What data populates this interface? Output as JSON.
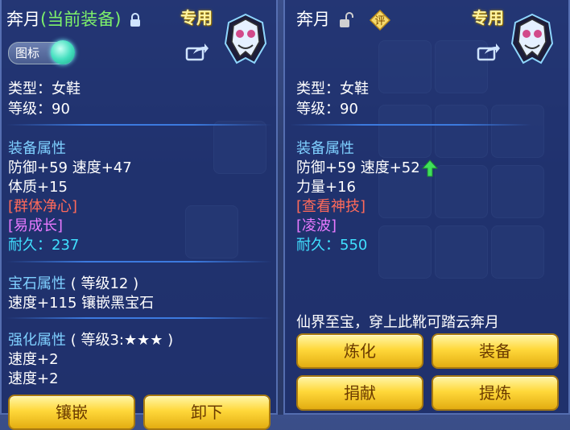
{
  "left": {
    "title_name": "奔月",
    "title_status": "(当前装备)",
    "exclusive": "专用",
    "toggle_label": "图标",
    "type": "类型：女鞋",
    "level": "等级：90",
    "equip_attr_header": "装备属性",
    "attr_line1": "防御+59 速度+47",
    "attr_line2": "体质+15",
    "skill1": "[群体净心]",
    "skill2": "[易成长]",
    "durability": "耐久：237",
    "gem_header": "宝石属性",
    "gem_level": "( 等级12 )",
    "gem_line": "速度+115 镶嵌黑宝石",
    "strength_header": "强化属性",
    "strength_level": "( 等级3:★★★ )",
    "strength_line1": "速度+2",
    "strength_line2": "速度+2",
    "btn_inlay": "镶嵌",
    "btn_unequip": "卸下"
  },
  "right": {
    "title_name": "奔月",
    "ping_badge": "评",
    "exclusive": "专用",
    "type": "类型：女鞋",
    "level": "等级：90",
    "equip_attr_header": "装备属性",
    "attr_line1": "防御+59 速度+52",
    "attr_line2": "力量+16",
    "skill1": "[查看神技]",
    "skill2": "[凌波]",
    "durability": "耐久：550",
    "description": "仙界至宝，穿上此靴可踏云奔月",
    "btn_refine": "炼化",
    "btn_equip": "装备",
    "btn_donate": "捐献",
    "btn_extract": "提炼"
  },
  "colors": {
    "section_header": "#7fd0ff",
    "skill_red": "#ff6a5a",
    "skill_purple": "#e87aff",
    "durability": "#40e0ff",
    "equipped": "#7ef26a",
    "button": "#ffd83a"
  }
}
